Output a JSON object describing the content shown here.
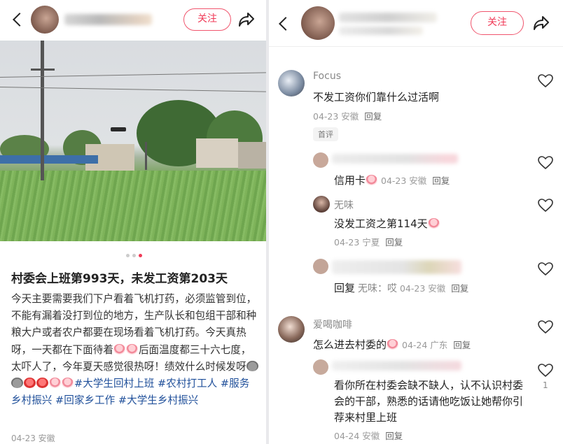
{
  "left": {
    "header": {
      "follow_label": "关注"
    },
    "post": {
      "title": "村委会上班第993天，未发工资第203天",
      "body_text_1": "今天主要需要我们下户看着飞机打药，必须监管到位，不能有漏着没打到位的地方，生产队长和包组干部和种粮大户或者农户都要在现场看着飞机打药。今天真热呀，一天都在下面待着",
      "body_text_2": "后面温度都三十六七度，太吓人了，今年夏天感觉很热呀！绩效什么时候发呀",
      "tags": [
        "#大学生回村上班",
        "#农村打工人",
        "#服务乡村振兴",
        "#回家乡工作",
        "#大学生乡村振兴"
      ],
      "meta": "04-23 安徽"
    }
  },
  "right": {
    "header": {
      "follow_label": "关注"
    },
    "comments": [
      {
        "name": "Focus",
        "text": "不发工资你们靠什么过活啊",
        "meta": "04-23 安徽",
        "reply": "回复",
        "badge": "首评"
      },
      {
        "name": "",
        "text": "信用卡",
        "meta": "04-23 安徽",
        "reply": "回复"
      },
      {
        "name": "无味",
        "text": "没发工资之第114天",
        "meta": "04-23 宁夏",
        "reply": "回复"
      },
      {
        "name": "",
        "text": "回复",
        "mention": "无味：哎",
        "meta": "04-23 安徽",
        "reply": "回复"
      },
      {
        "name": "爱喝咖啡",
        "text": "怎么进去村委的",
        "meta": "04-24 广东",
        "reply": "回复"
      },
      {
        "name": "",
        "text": "看你所在村委会缺不缺人，认不认识村委会的干部，熟悉的话请他吃饭让她帮你引荐来村里上班",
        "meta": "04-24 安徽",
        "reply": "回复",
        "like_count": "1"
      }
    ]
  },
  "icons": {
    "back": "chevron-left-icon",
    "share": "share-arrow-icon",
    "like": "heart-outline-icon"
  },
  "colors": {
    "accent": "#f03a57",
    "hashtag": "#1f4f9a"
  }
}
